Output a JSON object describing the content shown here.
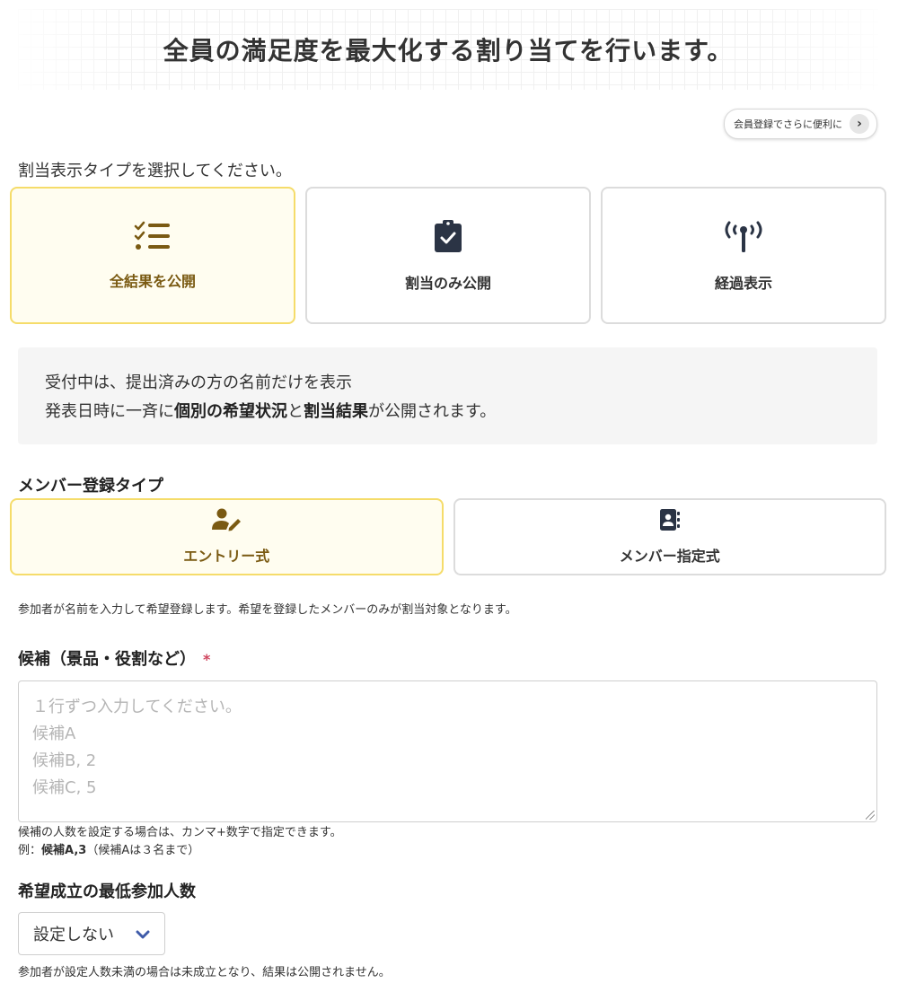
{
  "header": {
    "title": "全員の満足度を最大化する割り当てを行います。"
  },
  "signup": {
    "label": "会員登録でさらに便利に"
  },
  "display_type": {
    "label": "割当表示タイプを選択してください。",
    "options": [
      {
        "label": "全結果を公開",
        "icon": "checklist-icon",
        "selected": true
      },
      {
        "label": "割当のみ公開",
        "icon": "clipboard-check-icon",
        "selected": false
      },
      {
        "label": "経過表示",
        "icon": "broadcast-antenna-icon",
        "selected": false
      }
    ]
  },
  "info": {
    "line1": "受付中は、提出済みの方の名前だけを表示",
    "line2_pre": "発表日時に一斉に",
    "line2_b1": "個別の希望状況",
    "line2_mid": "と",
    "line2_b2": "割当結果",
    "line2_post": "が公開されます。"
  },
  "member_type": {
    "label": "メンバー登録タイプ",
    "options": [
      {
        "label": "エントリー式",
        "icon": "user-pen-icon",
        "selected": true
      },
      {
        "label": "メンバー指定式",
        "icon": "address-book-icon",
        "selected": false
      }
    ],
    "help": "参加者が名前を入力して希望登録します。希望を登録したメンバーのみが割当対象となります。"
  },
  "candidates": {
    "label": "候補（景品・役割など）",
    "required_mark": "*",
    "placeholder_lines": [
      "１行ずつ入力してください。",
      "候補A",
      "候補B, 2",
      "候補C, 5"
    ],
    "help_line1": "候補の人数を設定する場合は、カンマ+数字で指定できます。",
    "help_example_prefix": "例：",
    "help_example_bold": "候補A,3",
    "help_example_suffix": "（候補Aは３名まで）"
  },
  "min_participants": {
    "label": "希望成立の最低参加人数",
    "selected_value": "設定しない",
    "help": "参加者が設定人数未満の場合は未成立となり、結果は公開されません。"
  },
  "colors": {
    "selected_border": "#f5dc6a",
    "selected_bg": "#fffdf0",
    "selected_text": "#7a5a12",
    "icon_dark": "#2b3445",
    "required": "#d0455e",
    "chevron": "#3f5ba9"
  }
}
